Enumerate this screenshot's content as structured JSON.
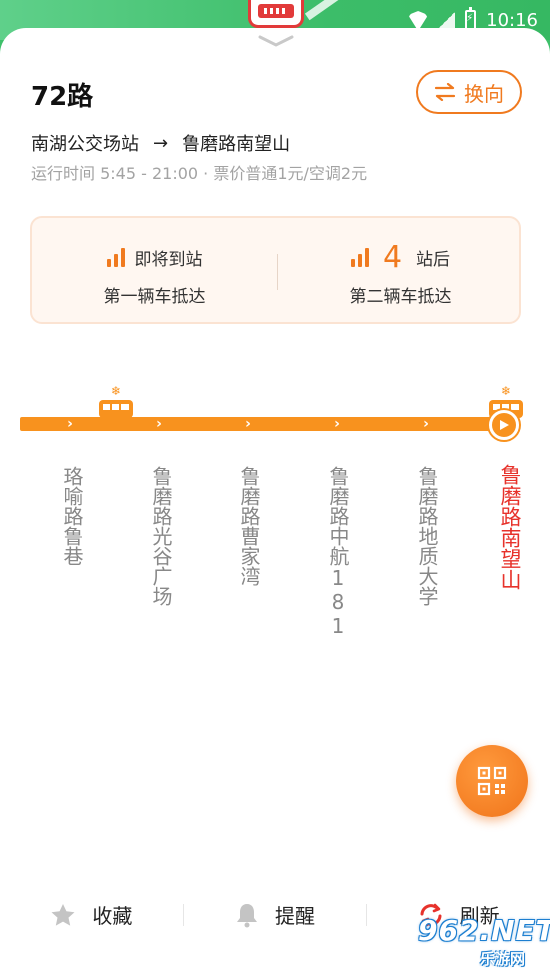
{
  "status_bar": {
    "time": "10:16"
  },
  "header": {
    "route_name": "72路",
    "switch_label": "换向"
  },
  "direction": {
    "from": "南湖公交场站",
    "arrow": "→",
    "to": "鲁磨路南望山"
  },
  "info": "运行时间 5:45 - 21:00 · 票价普通1元/空调2元",
  "arrival": {
    "first": {
      "status": "即将到站",
      "label": "第一辆车抵达"
    },
    "second": {
      "count": "4",
      "unit": "站后",
      "label": "第二辆车抵达"
    }
  },
  "stops": [
    {
      "name": "珞喻路鲁巷"
    },
    {
      "name": "鲁磨路光谷广场"
    },
    {
      "name": "鲁磨路曹家湾"
    },
    {
      "name": "鲁磨路中航181"
    },
    {
      "name": "鲁磨路地质大学"
    },
    {
      "name": "鲁磨路南望山",
      "active": true
    }
  ],
  "bottom_bar": {
    "favorite": "收藏",
    "remind": "提醒",
    "refresh": "刷新"
  },
  "watermark": {
    "text": "962.NET",
    "sub": "乐游网"
  },
  "colors": {
    "accent": "#f07a1f",
    "line": "#f8921e",
    "active_stop": "#e7322b",
    "status_bar": "#3ec06a"
  }
}
